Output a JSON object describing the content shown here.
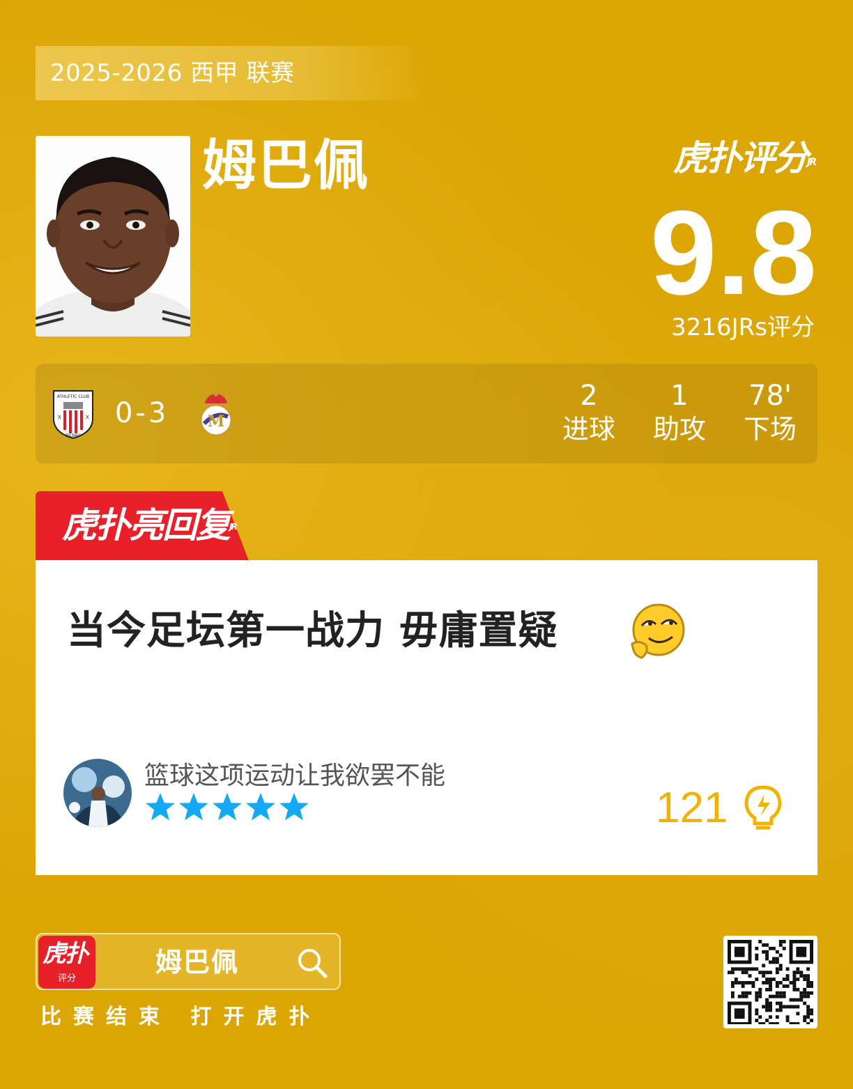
{
  "season": {
    "label": "2025-2026 西甲 联赛"
  },
  "player": {
    "name": "姆巴佩"
  },
  "brand": {
    "logo_text": "虎扑评分",
    "logo_jr": "JR"
  },
  "rating": {
    "score": "9.8",
    "count_label": "3216JRs评分"
  },
  "match": {
    "home_club": "ATHLETIC CLUB",
    "home_city": "BILBAO",
    "score": "0-3",
    "stats": [
      {
        "value": "2",
        "label": "进球"
      },
      {
        "value": "1",
        "label": "助攻"
      },
      {
        "value": "78'",
        "label": "下场"
      }
    ]
  },
  "highlight": {
    "tab_label": "虎扑亮回复",
    "tab_jr": "JR"
  },
  "reply": {
    "text": "当今足坛第一战力 毋庸置疑",
    "username": "篮球这项运动让我欲罢不能",
    "stars": 5,
    "likes": "121"
  },
  "footer": {
    "app_icon_text": "虎扑",
    "app_icon_sub": "评分",
    "search_value": "姆巴佩",
    "caption": "比赛结束 打开虎扑"
  },
  "colors": {
    "background": "#dba503",
    "accent_red": "#e8202a",
    "likes": "#f2b200",
    "star": "#12a9f5"
  }
}
